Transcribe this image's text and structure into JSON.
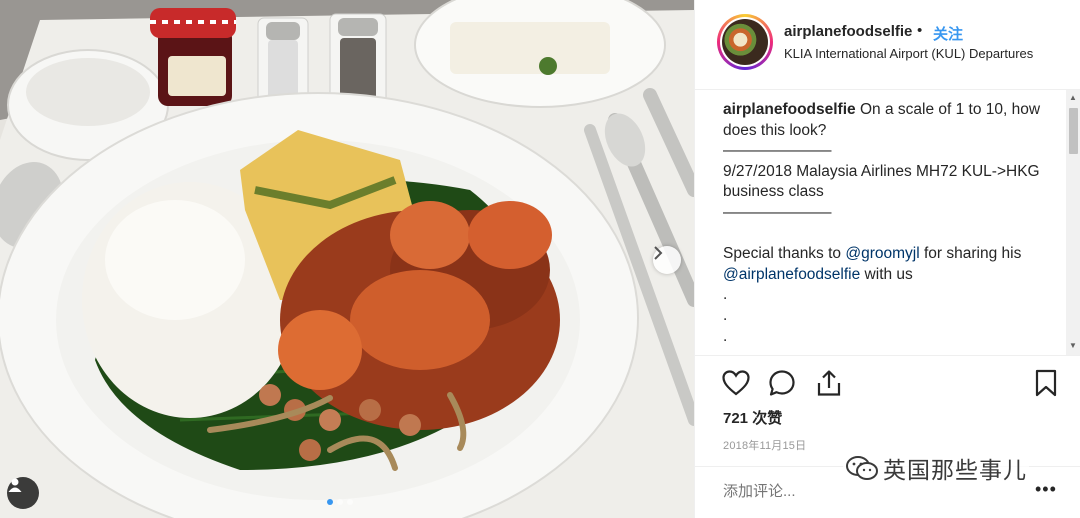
{
  "post": {
    "username": "airplanefoodselfie",
    "separator": "•",
    "follow_label": "关注",
    "location": "KLIA International Airport (KUL) Departures"
  },
  "caption": {
    "author": "airplanefoodselfie",
    "text1": "On a scale of 1 to 10, how does this look?",
    "rule1": "———————",
    "flight": "9/27/2018 Malaysia Airlines MH72 KUL->HKG business class",
    "rule2": "———————",
    "thanks_prefix": "Special thanks to ",
    "mention1": "@groomyjl",
    "thanks_mid": " for sharing his ",
    "mention2": "@airplanefoodselfie",
    "thanks_suffix": " with us",
    "dots": [
      ".",
      ".",
      ".",
      "."
    ]
  },
  "actions": {
    "likes": "721 次赞",
    "date": "2018年11月15日",
    "comment_placeholder": "添加评论...",
    "more": "•••"
  },
  "watermark": "英国那些事儿",
  "carousel": {
    "count": 3,
    "active": 0
  },
  "icons": [
    "heart-icon",
    "comment-icon",
    "share-icon",
    "bookmark-icon",
    "chevron-right-icon",
    "person-tag-icon"
  ],
  "colors": {
    "link_blue": "#3897f0",
    "mention_blue": "#003569",
    "muted_gray": "#999999"
  }
}
